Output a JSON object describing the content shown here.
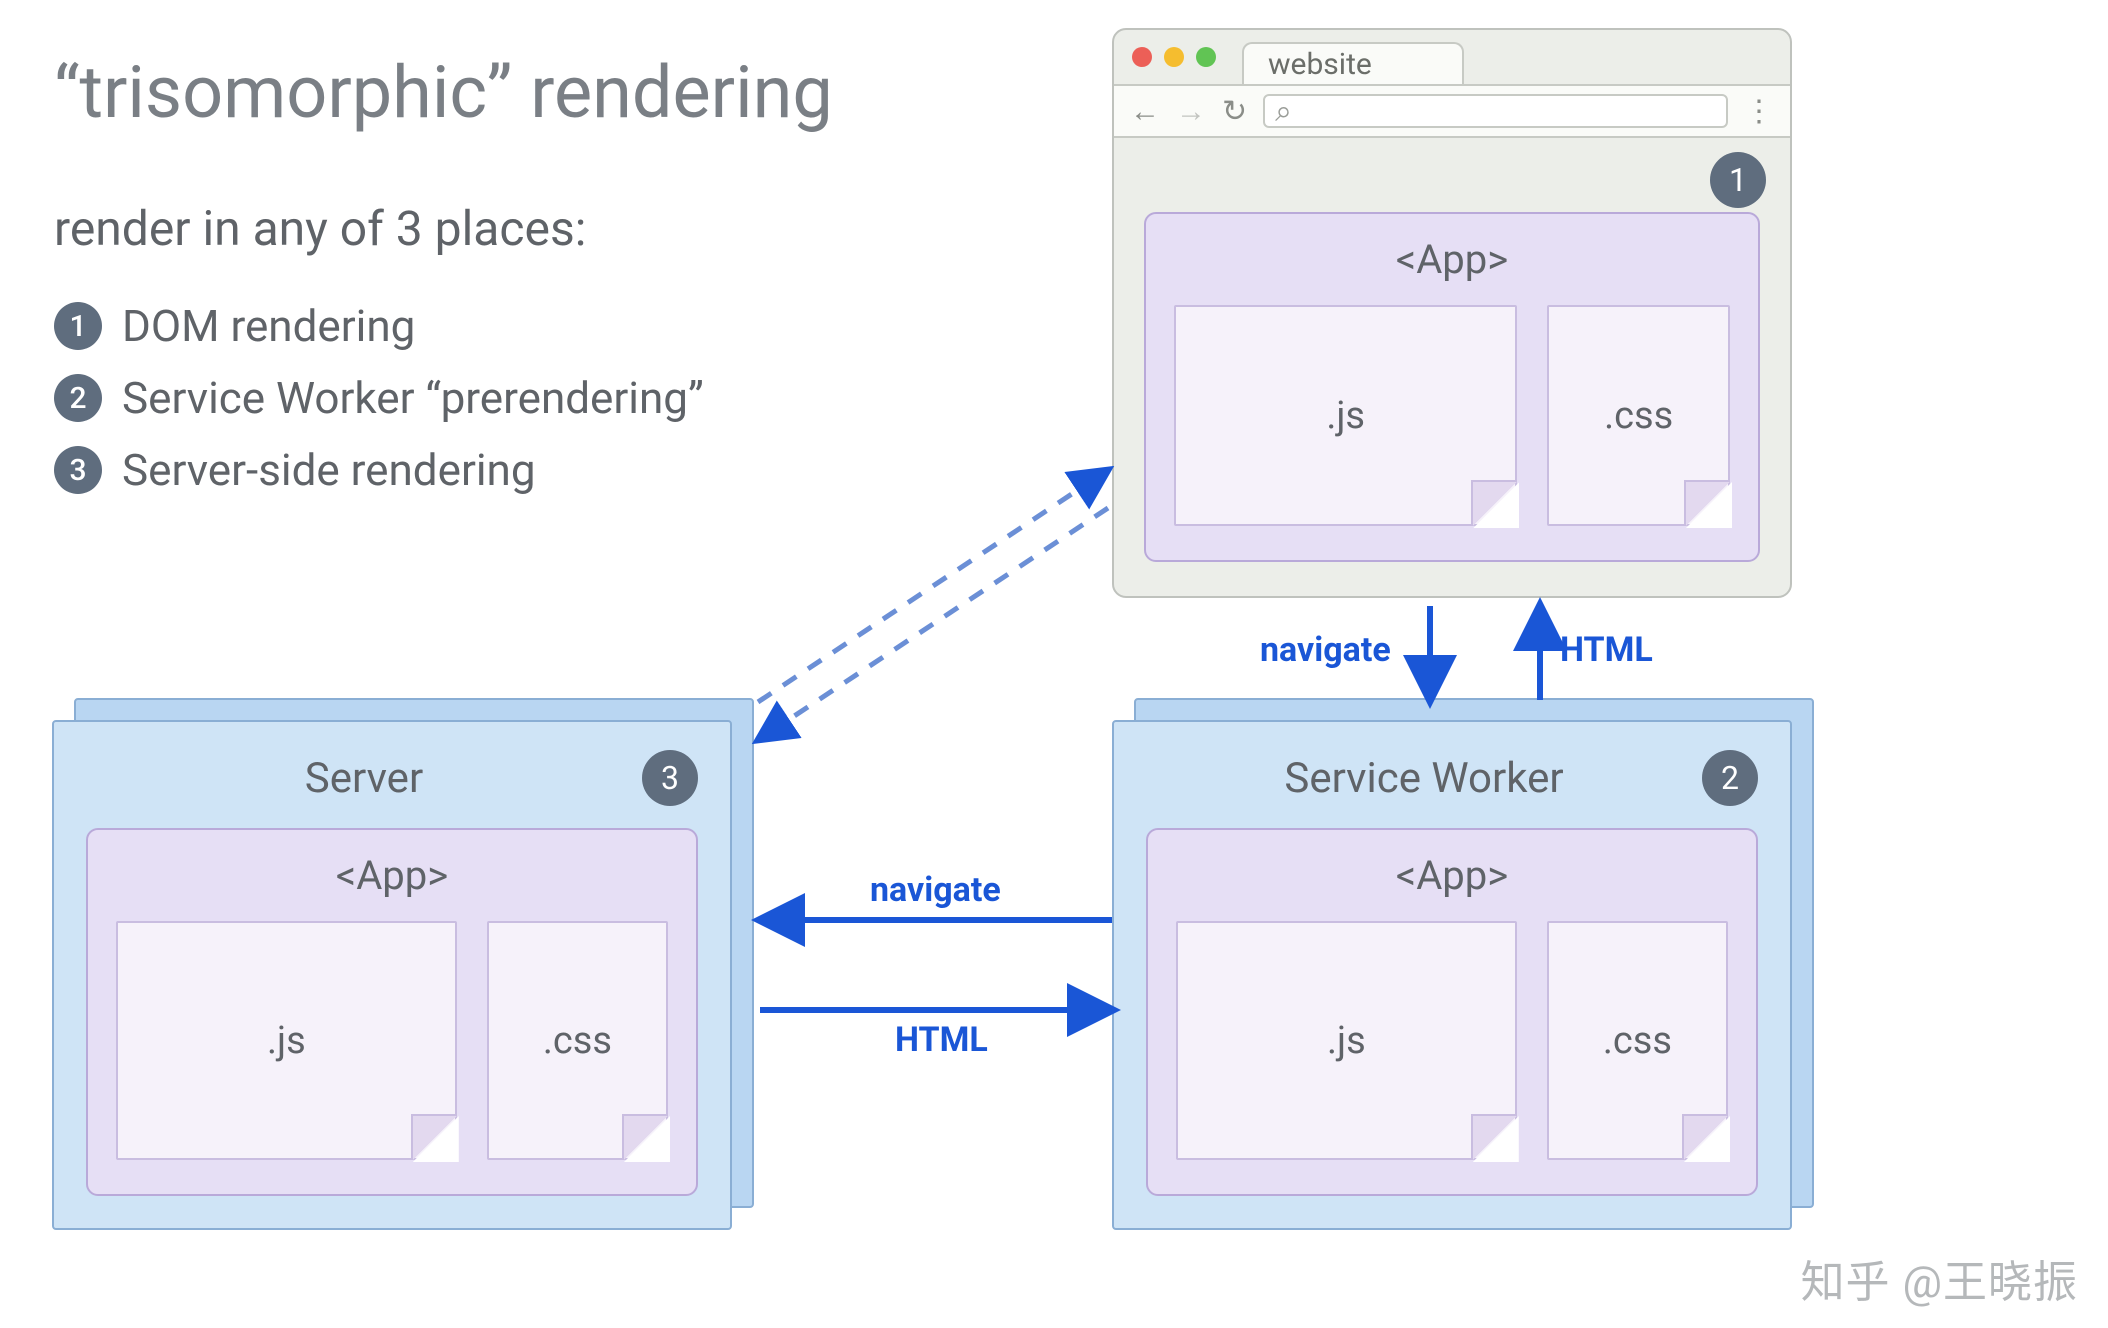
{
  "title": "“trisomorphic” rendering",
  "subtitle": "render in any of 3 places:",
  "list": [
    {
      "n": "1",
      "label": "DOM rendering"
    },
    {
      "n": "2",
      "label": "Service Worker “prerendering”"
    },
    {
      "n": "3",
      "label": "Server-side rendering"
    }
  ],
  "browser": {
    "tab": "website",
    "search_icon": "⌕",
    "badge": "1",
    "app": {
      "label": "<App>",
      "file_js": ".js",
      "file_css": ".css"
    }
  },
  "server": {
    "title": "Server",
    "badge": "3",
    "app": {
      "label": "<App>",
      "file_js": ".js",
      "file_css": ".css"
    }
  },
  "sw": {
    "title": "Service Worker",
    "badge": "2",
    "app": {
      "label": "<App>",
      "file_js": ".js",
      "file_css": ".css"
    }
  },
  "arrows": {
    "browser_to_sw": "navigate",
    "sw_to_browser": "HTML",
    "sw_to_server": "navigate",
    "server_to_sw": "HTML"
  },
  "watermark": "知乎 @王晓振",
  "colors": {
    "badge_bg": "#5f6d7e",
    "panel_fill": "#cfe4f6",
    "panel_border": "#8aaed4",
    "app_fill": "#e6dff5",
    "app_border": "#b9a9d9",
    "arrow": "#1a56d6"
  }
}
